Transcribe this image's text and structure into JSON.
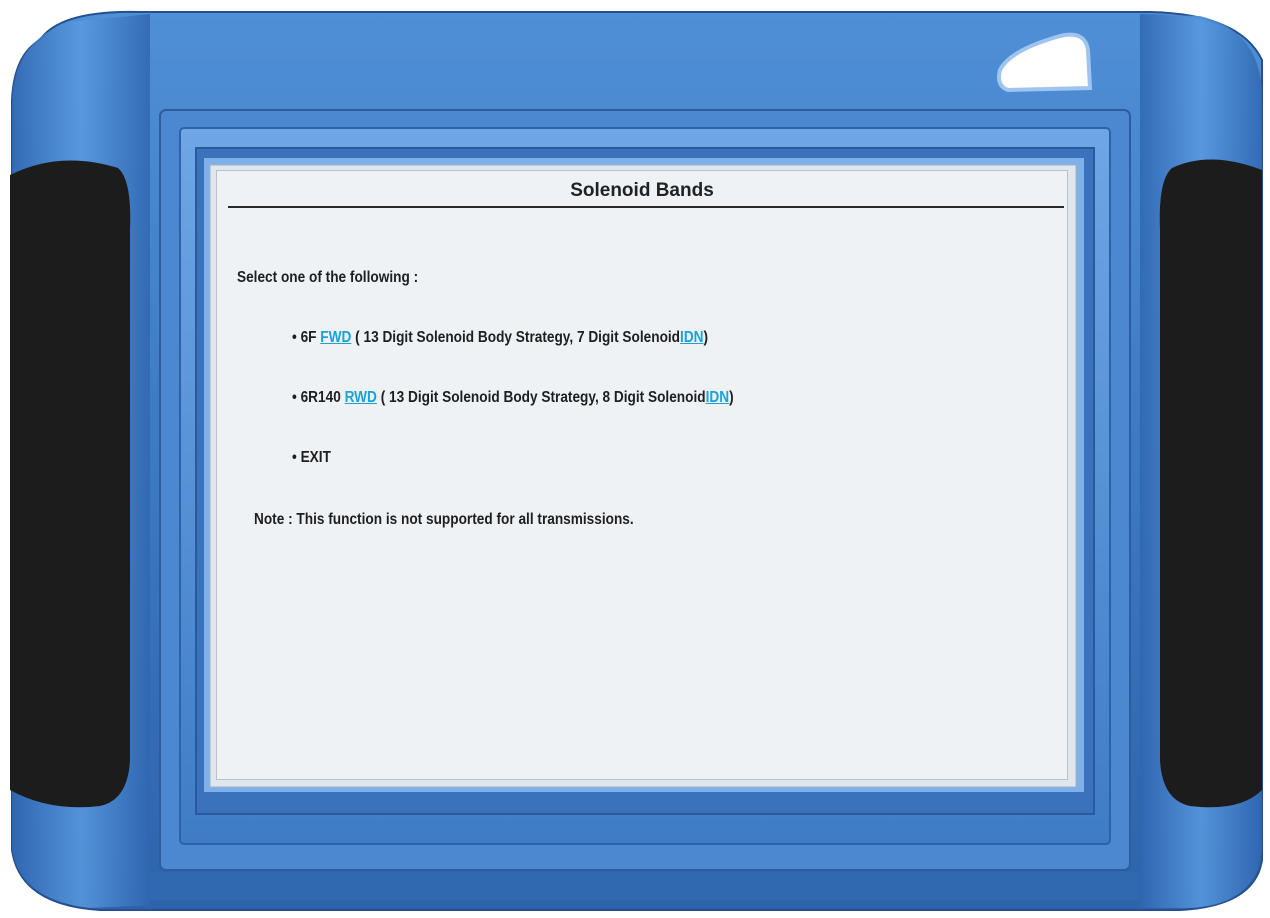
{
  "screen": {
    "title": "Solenoid Bands",
    "prompt": "Select one of the following :",
    "options": [
      {
        "bullet": "•",
        "prefix": "6F",
        "link": "FWD",
        "description": "( 13   Digit Solenoid Body Strategy, 7  Digit Solenoid",
        "link2": "IDN",
        "suffix": ")"
      },
      {
        "bullet": "•",
        "prefix": "6R140",
        "link": "RWD",
        "description": "( 13   Digit Solenoid Body Strategy, 8  Digit Solenoid",
        "link2": "IDN",
        "suffix": ")"
      },
      {
        "bullet": "•",
        "label": "EXIT"
      }
    ],
    "note": "Note : This function is not supported for all transmissions."
  },
  "colors": {
    "frame_blue": "#3f7fc9",
    "frame_dark_blue": "#2b5fa8",
    "grip_black": "#1c1c1c",
    "link": "#1aa3d6",
    "screen_bg": "#eef2f5"
  }
}
